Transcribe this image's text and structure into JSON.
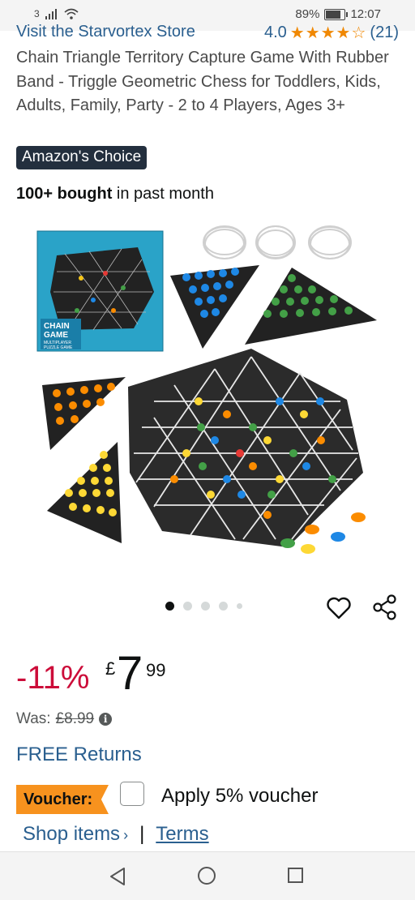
{
  "status_bar": {
    "carrier": "3",
    "battery": "89%",
    "battery_level": 0.89,
    "time": "12:07"
  },
  "store_link": "Visit the Starvortex Store",
  "rating": {
    "value": "4.0",
    "stars": "★★★★☆",
    "count": "(21)"
  },
  "product": {
    "title": "Chain Triangle Territory Capture Game With Rubber Band - Triggle Geometric Chess for Toddlers, Kids, Adults, Family, Party - 2 to 4 Players, Ages 3+",
    "badge": "Amazon's Choice",
    "bought_bold": "100+ bought",
    "bought_rest": " in past month",
    "box_label_1": "CHAIN",
    "box_label_2": "GAME",
    "box_label_3": "MULTIPLAYER",
    "box_label_4": "PUZZLE GAME"
  },
  "gallery": {
    "current": 1,
    "total": 5
  },
  "price": {
    "discount": "-11%",
    "currency": "£",
    "whole": "7",
    "fraction": "99",
    "was_label": "Was:",
    "was_price": "£8.99"
  },
  "free_returns": "FREE Returns",
  "voucher": {
    "tag": "Voucher:",
    "apply_label": "Apply 5% voucher"
  },
  "links": {
    "shop_items": "Shop items",
    "separator": "|",
    "terms": "Terms"
  },
  "colors": {
    "accent_link": "#2a5f8f",
    "discount": "#cc0c39",
    "voucher": "#f7921e",
    "badge_bg": "#232f3e",
    "star": "#f08804"
  }
}
